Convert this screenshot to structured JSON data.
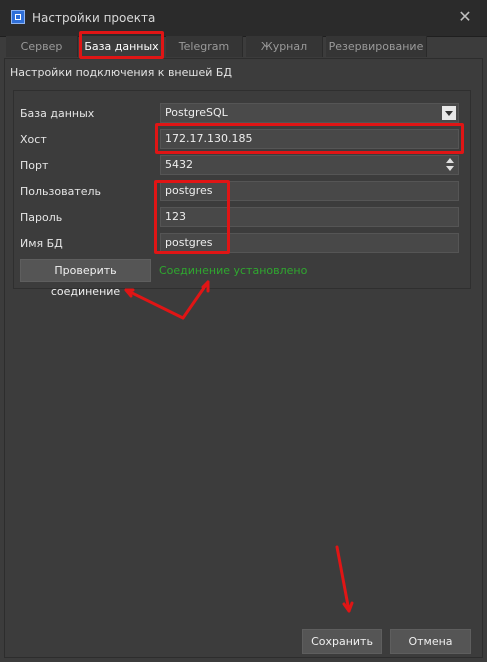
{
  "window": {
    "title": "Настройки проекта"
  },
  "tabs": [
    "Сервер",
    "База данных",
    "Telegram",
    "Журнал",
    "Резервирование"
  ],
  "section_title": "Настройки подключения к внешей БД",
  "form": {
    "db_label": "База данных",
    "db_value": "PostgreSQL",
    "host_label": "Хост",
    "host_value": "172.17.130.185",
    "port_label": "Порт",
    "port_value": "5432",
    "user_label": "Пользователь",
    "user_value": "postgres",
    "password_label": "Пароль",
    "password_value": "123",
    "dbname_label": "Имя БД",
    "dbname_value": "postgres"
  },
  "test_button": "Проверить соединение",
  "status_text": "Соединение установлено",
  "footer": {
    "save": "Сохранить",
    "cancel": "Отмена"
  },
  "colors": {
    "highlight": "#e01515",
    "status_ok": "#2fa82f"
  },
  "icons": {
    "app": "app-icon",
    "close": "close-icon"
  }
}
